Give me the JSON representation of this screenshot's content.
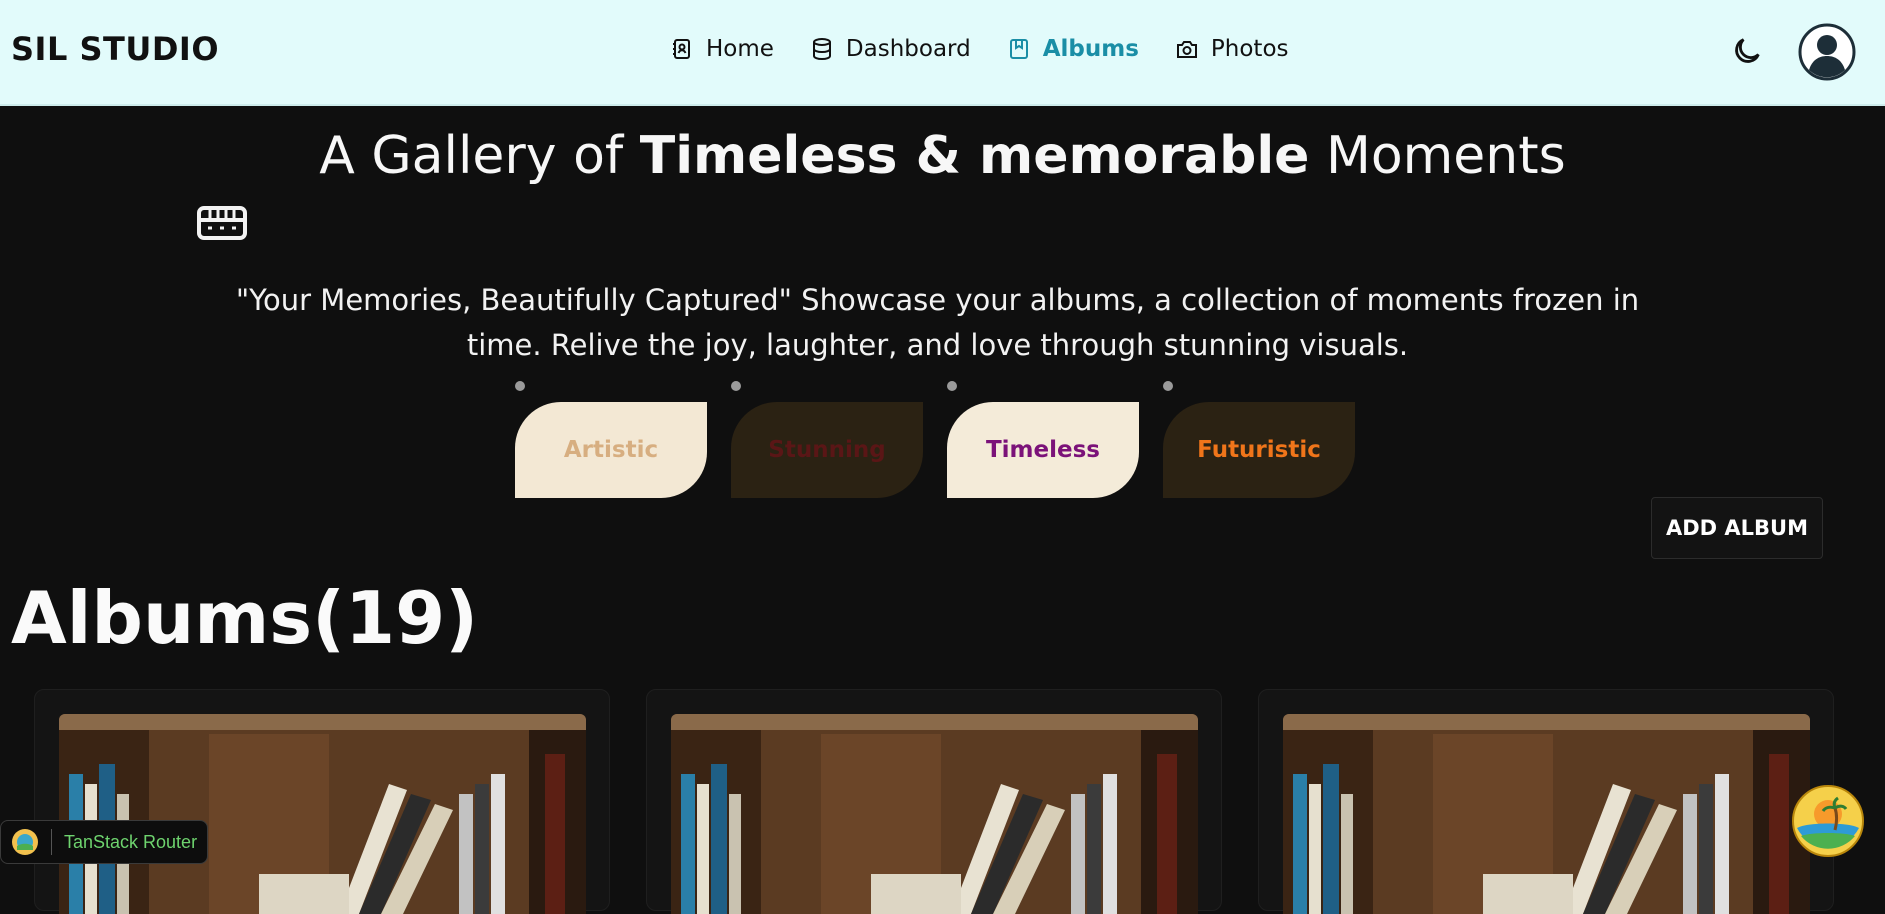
{
  "brand": "SIL STUDIO",
  "nav": {
    "items": [
      {
        "label": "Home",
        "icon": "contact-book-icon"
      },
      {
        "label": "Dashboard",
        "icon": "database-icon"
      },
      {
        "label": "Albums",
        "icon": "bookmark-book-icon",
        "active": true
      },
      {
        "label": "Photos",
        "icon": "camera-icon"
      }
    ]
  },
  "header_icons": {
    "theme": "moon-icon",
    "avatar": "user-avatar-icon"
  },
  "hero": {
    "title_pre": "A Gallery of ",
    "title_bold": "Timeless & memorable",
    "title_post": " Moments",
    "icon": "memory-chip-icon",
    "description": "\"Your Memories, Beautifully Captured\" Showcase your albums, a collection of moments frozen in time. Relive the joy, laughter, and love through stunning visuals."
  },
  "tags": [
    {
      "label": "Artistic",
      "bg": "#f3e8d4",
      "fg": "#d7ae80"
    },
    {
      "label": "Stunning",
      "bg": "#2b2213",
      "fg": "#5a1616"
    },
    {
      "label": "Timeless",
      "bg": "#f4ebd9",
      "fg": "#7b1279"
    },
    {
      "label": "Futuristic",
      "bg": "#2b2213",
      "fg": "#f0751a"
    }
  ],
  "add_album_label": "ADD ALBUM",
  "albums_title": "Albums(19)",
  "albums_count": 19,
  "album_cards_visible": 3,
  "devtools": {
    "label": "TanStack Router"
  },
  "colors": {
    "accent": "#1a8ea6",
    "topbar": "#e2fbfb",
    "background": "#0f0f0f"
  }
}
